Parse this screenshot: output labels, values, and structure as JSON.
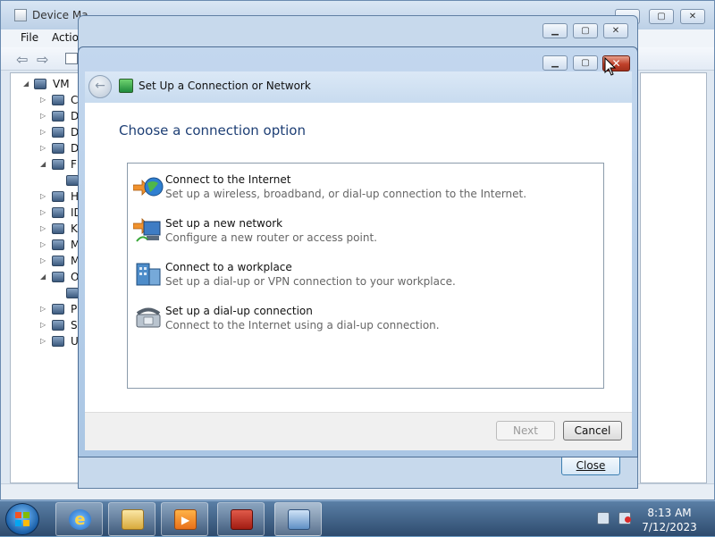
{
  "device_manager": {
    "title": "Device Ma",
    "menu": [
      "File",
      "Actio"
    ],
    "tree_root": "VM",
    "tree_items": [
      "C",
      "D",
      "D",
      "D",
      "Fl",
      "",
      "H",
      "ID",
      "K",
      "M",
      "M",
      "O",
      "",
      "P",
      "Sy",
      "U"
    ]
  },
  "middle_dialog": {
    "close_label": "Close"
  },
  "dialog": {
    "title": "Set Up a Connection or Network",
    "heading": "Choose a connection option",
    "options": [
      {
        "title": "Connect to the Internet",
        "desc": "Set up a wireless, broadband, or dial-up connection to the Internet.",
        "icon": "globe-icon"
      },
      {
        "title": "Set up a new network",
        "desc": "Configure a new router or access point.",
        "icon": "router-icon"
      },
      {
        "title": "Connect to a workplace",
        "desc": "Set up a dial-up or VPN connection to your workplace.",
        "icon": "building-icon"
      },
      {
        "title": "Set up a dial-up connection",
        "desc": "Connect to the Internet using a dial-up connection.",
        "icon": "telephone-icon"
      }
    ],
    "next_label": "Next",
    "cancel_label": "Cancel",
    "close_glyph": "✕"
  },
  "taskbar": {
    "time": "8:13 AM",
    "date": "7/12/2023",
    "apps": [
      "internet-explorer-icon",
      "file-explorer-icon",
      "media-player-icon",
      "toolbox-icon",
      "control-panel-icon"
    ]
  },
  "colors": {
    "heading": "#1e3f75",
    "close_red": "#c0412a"
  }
}
